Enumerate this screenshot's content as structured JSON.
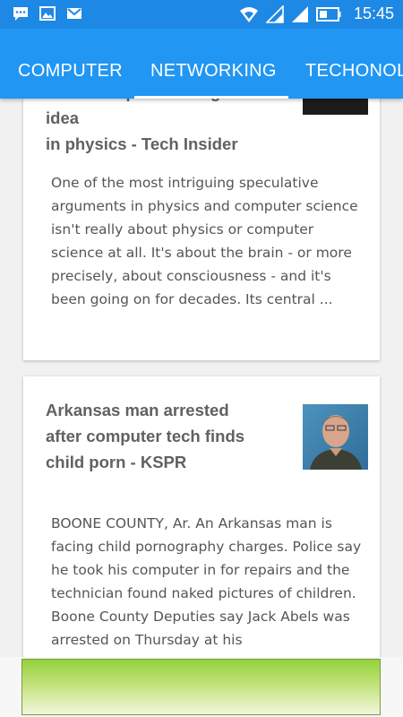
{
  "status_bar": {
    "time": "15:45",
    "left_icons": [
      "chat-icon",
      "image-icon",
      "gmail-icon"
    ],
    "right_icons": [
      "wifi-icon",
      "signal-icon",
      "signal-icon",
      "battery-icon"
    ]
  },
  "tabs": [
    {
      "label": "COMPUTER",
      "selected": false
    },
    {
      "label": "NETWORKING",
      "selected": true
    },
    {
      "label": "TECHONOL",
      "selected": false
    }
  ],
  "articles": [
    {
      "title_line_partial": "Must accept this thing's idea",
      "title_line": "in physics - Tech Insider",
      "body": "One of the most intriguing speculative arguments in physics and computer science isn't really about physics or computer science at all. It's about the brain - or more precisely, about consciousness - and it's been going on for decades. Its central ..."
    },
    {
      "title": "Arkansas man arrested after computer tech finds child porn - KSPR",
      "body": "BOONE COUNTY, Ar. An Arkansas man is facing child pornography charges. Police say he took his computer in for repairs and the technician found naked pictures of children. Boone County Deputies say Jack Abels was arrested on Thursday at his"
    }
  ],
  "colors": {
    "status_bar": "#1e88e5",
    "tab_bar": "#2196f3",
    "ad_green": "#93d13a"
  }
}
